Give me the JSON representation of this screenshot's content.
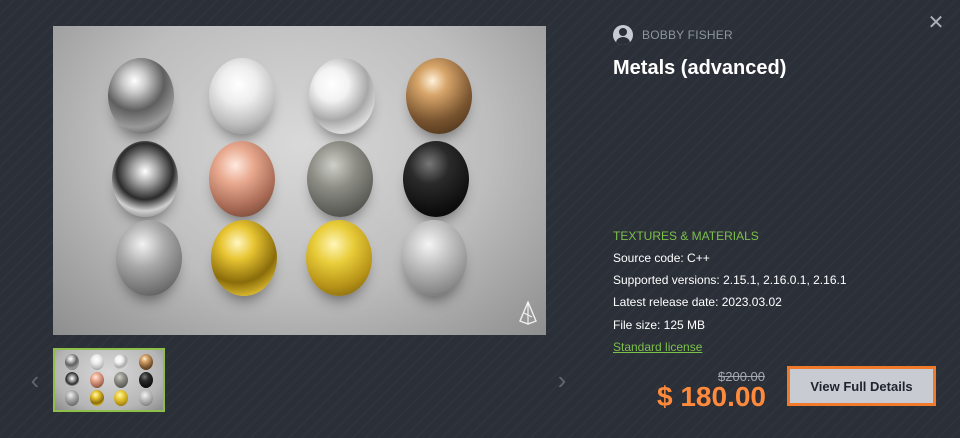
{
  "product": {
    "author": "BOBBY FISHER",
    "title": "Metals (advanced)",
    "category": "TEXTURES & MATERIALS",
    "source_code": "Source code: C++",
    "supported_versions": "Supported versions: 2.15.1, 2.16.0.1, 2.16.1",
    "release_date": "Latest release date: 2023.03.02",
    "file_size": "File size: 125 MB",
    "license": "Standard license",
    "old_price": "$200.00",
    "price": "$ 180.00",
    "cta": "View Full Details"
  },
  "controls": {
    "close": "✕",
    "prev": "‹",
    "next": "›"
  },
  "colors": {
    "background": "#2a2f38",
    "accent_green": "#7cc04a",
    "price_orange": "#ff8a3c",
    "button_border": "#f07a2a",
    "button_bg": "#c8ccd2"
  },
  "icons": [
    "avatar-icon",
    "close-icon",
    "chevron-left-icon",
    "chevron-right-icon",
    "watermark-logo-icon"
  ]
}
